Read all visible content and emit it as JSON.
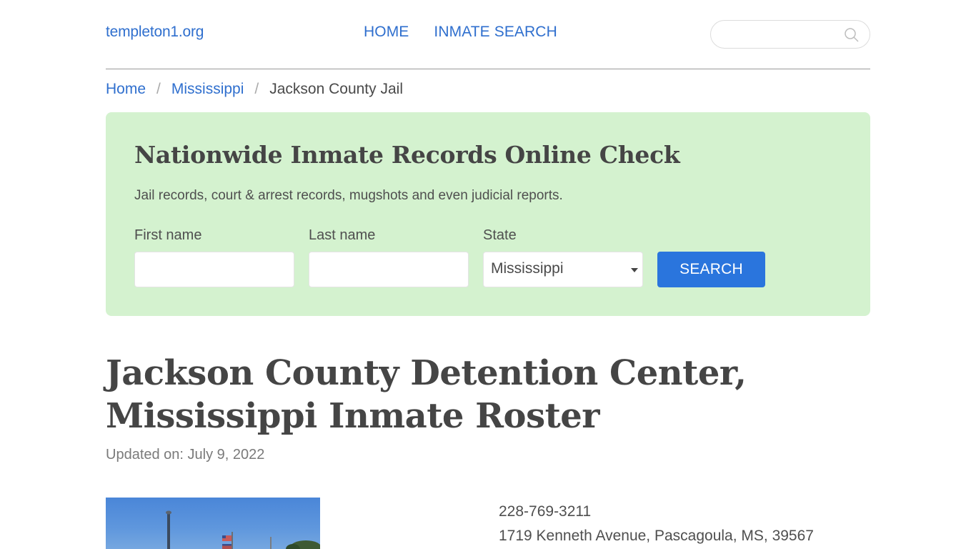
{
  "header": {
    "logo": "templeton1.org",
    "nav": [
      {
        "label": "HOME"
      },
      {
        "label": "INMATE SEARCH"
      }
    ],
    "search": {
      "placeholder": "",
      "value": "",
      "icon": "search-icon"
    }
  },
  "breadcrumb": {
    "items": [
      {
        "label": "Home"
      },
      {
        "label": "Mississippi"
      },
      {
        "label": "Jackson County Jail"
      }
    ],
    "separator": "/"
  },
  "promo": {
    "title": "Nationwide Inmate Records Online Check",
    "subtitle": "Jail records, court & arrest records, mugshots and even judicial reports.",
    "first_name": {
      "label": "First name",
      "value": ""
    },
    "last_name": {
      "label": "Last name",
      "value": ""
    },
    "state": {
      "label": "State",
      "value": "Mississippi"
    },
    "button": "SEARCH"
  },
  "main": {
    "title": "Jackson County Detention Center, Mississippi Inmate Roster",
    "updated": "Updated on: July 9, 2022",
    "phone": "228-769-3211",
    "address": "1719 Kenneth Avenue, Pascagoula, MS, 39567",
    "photo_alt": "Jackson County Detention Center exterior with flags"
  },
  "colors": {
    "link": "#2f6fce",
    "promo_bg": "#d4f2cf",
    "button": "#2a75dd",
    "text": "#4a4a4a"
  }
}
